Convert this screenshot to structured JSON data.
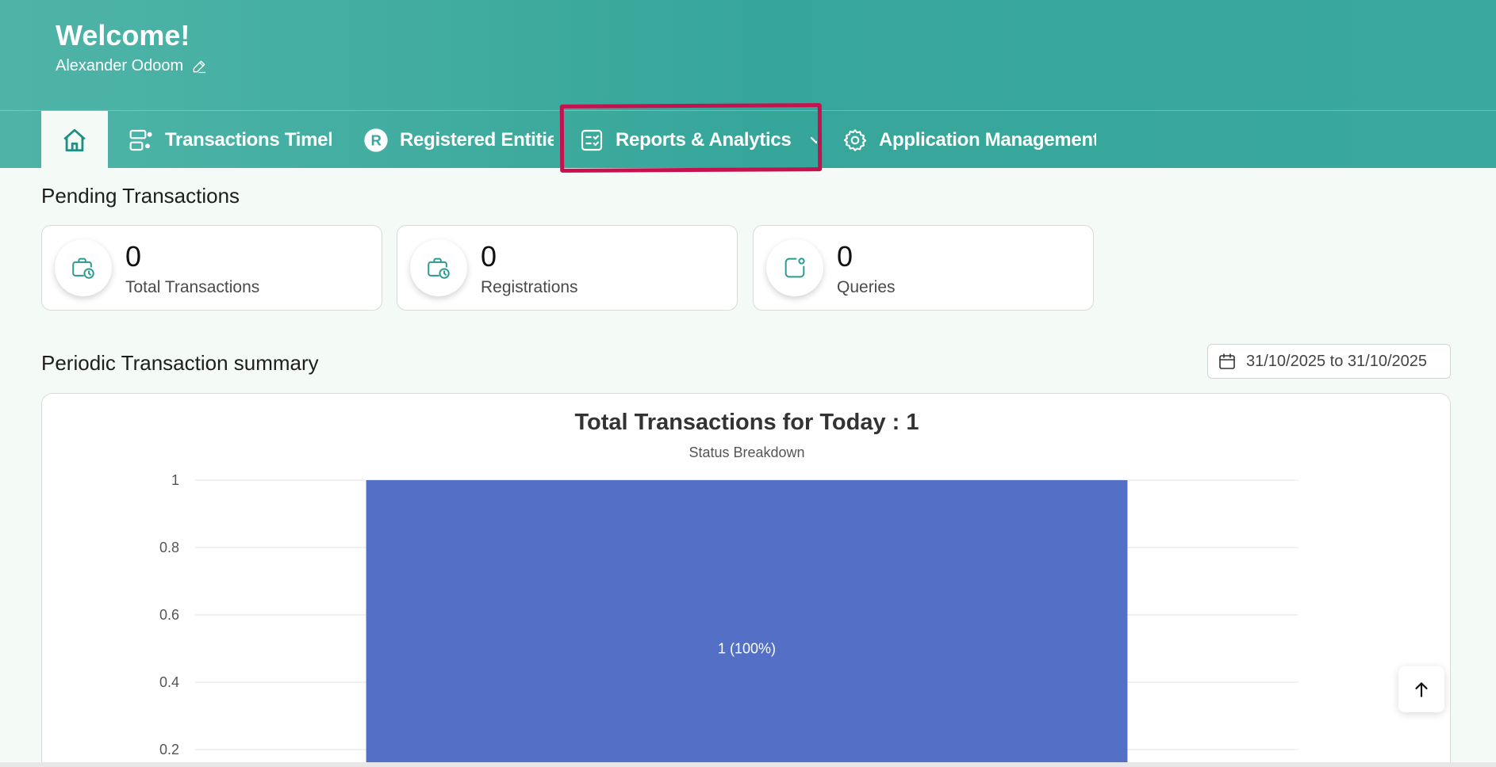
{
  "header": {
    "welcome": "Welcome!",
    "user_name": "Alexander Odoom",
    "edit_icon": "pencil-icon"
  },
  "nav": {
    "items": [
      {
        "label": "",
        "icon": "home-icon",
        "active": true
      },
      {
        "label": "Transactions Timeline",
        "icon": "timeline-icon"
      },
      {
        "label": "Registered Entities",
        "icon": "registered-r-icon"
      },
      {
        "label": "Reports & Analytics",
        "icon": "report-checklist-icon",
        "has_dropdown": true
      },
      {
        "label": "Application Management",
        "icon": "gear-icon"
      }
    ]
  },
  "pending": {
    "title": "Pending Transactions",
    "cards": [
      {
        "count": "0",
        "label": "Total Transactions",
        "icon": "briefcase-clock-icon"
      },
      {
        "count": "0",
        "label": "Registrations",
        "icon": "briefcase-clock-icon"
      },
      {
        "count": "0",
        "label": "Queries",
        "icon": "notification-square-icon"
      }
    ]
  },
  "periodic": {
    "title": "Periodic Transaction summary",
    "date_range": "31/10/2025 to 31/10/2025"
  },
  "chart_data": {
    "type": "bar",
    "title": "Total Transactions for Today : 1",
    "subtitle": "Status Breakdown",
    "categories": [
      ""
    ],
    "values": [
      1
    ],
    "data_labels": [
      "1 (100%)"
    ],
    "yticks": [
      "1",
      "0.8",
      "0.6",
      "0.4",
      "0.2"
    ],
    "ylim": [
      0,
      1
    ],
    "grid": true,
    "bar_color": "#5470c6"
  },
  "colors": {
    "header": "#3aa89c",
    "accent": "#2b9b8e",
    "highlight": "#c4124f",
    "background": "#f4faf5"
  }
}
